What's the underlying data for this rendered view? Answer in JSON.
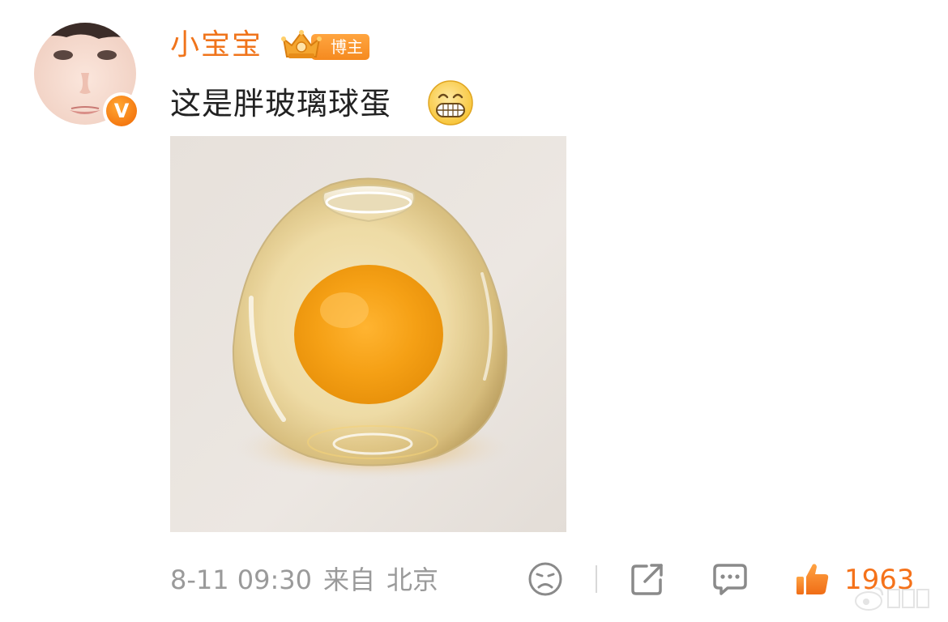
{
  "post": {
    "username": "小宝宝",
    "badge_label": "博主",
    "verified_mark": "V",
    "text": "这是胖玻璃球蛋",
    "emoji": "grinning-face-emoji",
    "image": "glass-egg-photo"
  },
  "footer": {
    "date": "8-11 09:30",
    "source_prefix": "来自",
    "location": "北京",
    "like_count": "1963"
  },
  "icons": {
    "dislike": "sad-face-icon",
    "share": "share-icon",
    "comment": "comment-icon",
    "like": "thumbs-up-icon"
  },
  "colors": {
    "accent": "#f0741b",
    "meta_text": "#9a9a9a",
    "icon_gray": "#8a8a8a"
  }
}
